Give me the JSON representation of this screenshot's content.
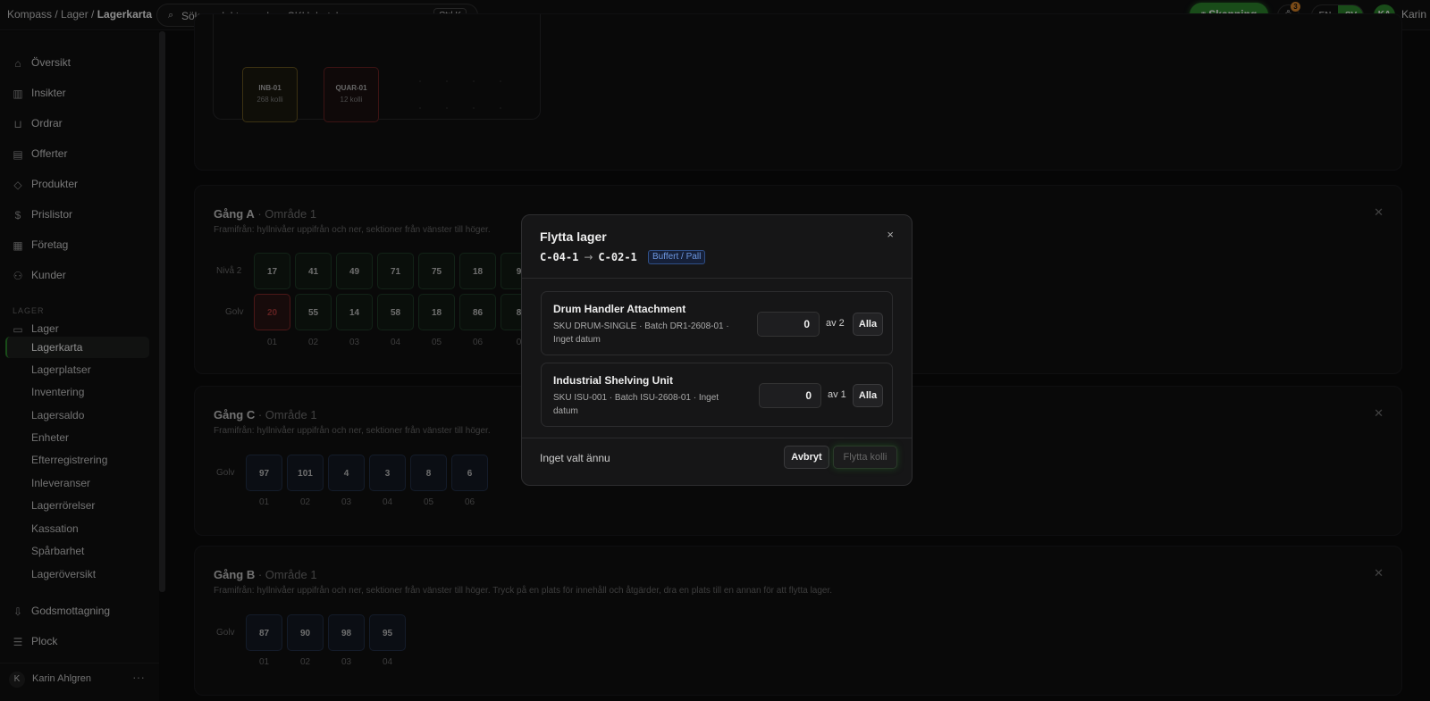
{
  "breadcrumb": {
    "part1": "Kompass / Lager / ",
    "current": "Lagerkarta"
  },
  "search": {
    "placeholder": "Sök produkter, ordrar, SKU, batch...",
    "shortcut": "Ctrl K"
  },
  "header": {
    "scan_label": "Skanning",
    "notif_count": "3",
    "lang_en": "EN",
    "lang_sv": "SV",
    "avatar_initials": "KA",
    "user_name": "Karin"
  },
  "sidebar": {
    "items": [
      {
        "label": "Översikt",
        "icon": "home-icon"
      },
      {
        "label": "Insikter",
        "icon": "chart-icon"
      },
      {
        "label": "Ordrar",
        "icon": "cart-icon"
      },
      {
        "label": "Offerter",
        "icon": "document-icon"
      },
      {
        "label": "Produkter",
        "icon": "tag-icon"
      },
      {
        "label": "Prislistor",
        "icon": "dollar-icon"
      },
      {
        "label": "Företag",
        "icon": "building-icon"
      },
      {
        "label": "Kunder",
        "icon": "users-icon"
      }
    ],
    "section_label": "LAGER",
    "lager_label": "Lager",
    "sub_items": [
      "Lagerkarta",
      "Lagerplatser",
      "Inventering",
      "Lagersaldo",
      "Enheter",
      "Efterregistrering",
      "Inleveranser",
      "Lagerrörelser",
      "Kassation",
      "Spårbarhet",
      "Lageröversikt"
    ],
    "bottom_items": [
      {
        "label": "Godsmottagning",
        "icon": "download-icon"
      },
      {
        "label": "Plock",
        "icon": "list-icon"
      }
    ],
    "footer": {
      "initial": "K",
      "name": "Karin Ahlgren",
      "more": "···"
    }
  },
  "zones": [
    {
      "name": "INB-01",
      "count": "268 kolli",
      "type": "inb"
    },
    {
      "name": "QUAR-01",
      "count": "12 kolli",
      "type": "quar"
    }
  ],
  "aisles": {
    "a": {
      "title": "Gång A",
      "area": " · Område 1",
      "subtitle": "Framifrån: hyllnivåer uppifrån och ner, sektioner från vänster till höger.",
      "row1_label": "Nivå 2",
      "row1": [
        "17",
        "41",
        "49",
        "71",
        "75",
        "18",
        "9"
      ],
      "row2_label": "Golv",
      "row2": [
        "20",
        "55",
        "14",
        "58",
        "18",
        "86",
        "8"
      ],
      "cols": [
        "01",
        "02",
        "03",
        "04",
        "05",
        "06",
        "0"
      ]
    },
    "c": {
      "title": "Gång C",
      "area": " · Område 1",
      "subtitle": "Framifrån: hyllnivåer uppifrån och ner, sektioner från vänster till höger.",
      "row_label": "Golv",
      "row": [
        "97",
        "101",
        "4",
        "3",
        "8",
        "6"
      ],
      "cols": [
        "01",
        "02",
        "03",
        "04",
        "05",
        "06"
      ]
    },
    "b": {
      "title": "Gång B",
      "area": " · Område 1",
      "subtitle": "Framifrån: hyllnivåer uppifrån och ner, sektioner från vänster till höger. Tryck på en plats för innehåll och åtgärder, dra en plats till en annan för att flytta lager.",
      "row_label": "Golv",
      "row": [
        "87",
        "90",
        "98",
        "95"
      ],
      "cols": [
        "01",
        "02",
        "03",
        "04"
      ]
    }
  },
  "modal": {
    "title": "Flytta lager",
    "from": "C-04-1",
    "arrow": "→",
    "to": "C-02-1",
    "badge": "Buffert / Pall",
    "items": [
      {
        "name": "Drum Handler Attachment",
        "meta": "SKU DRUM-SINGLE · Batch DR1-2608-01 · Inget datum",
        "qty": "0",
        "of": "av 2",
        "all": "Alla"
      },
      {
        "name": "Industrial Shelving Unit",
        "meta": "SKU ISU-001 · Batch ISU-2608-01 · Inget datum",
        "qty": "0",
        "of": "av 1",
        "all": "Alla"
      }
    ],
    "none_selected": "Inget valt ännu",
    "cancel": "Avbryt",
    "move": "Flytta kolli",
    "close": "×"
  }
}
